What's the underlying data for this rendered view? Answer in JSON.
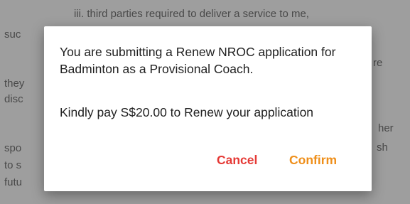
{
  "background": {
    "lines": [
      "iii. third parties required to deliver a service to me,",
      "suc",
      "re",
      "they",
      "disc",
      "her",
      "spo",
      "sh",
      "to s",
      "futu"
    ]
  },
  "dialog": {
    "message": "You are submitting a Renew NROC application for Badminton as a Provisional Coach.",
    "payment": "Kindly pay S$20.00 to Renew your application",
    "cancel_label": "Cancel",
    "confirm_label": "Confirm",
    "colors": {
      "cancel": "#e53935",
      "confirm": "#ef8f1a"
    }
  }
}
